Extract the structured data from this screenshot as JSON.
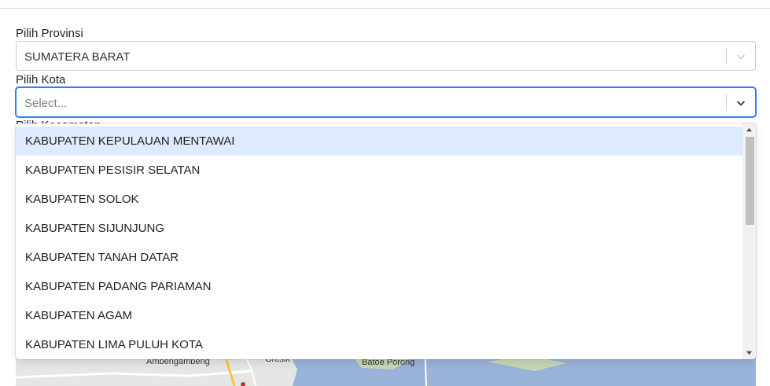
{
  "form": {
    "province_label": "Pilih Provinsi",
    "province_value": "SUMATERA BARAT",
    "city_label": "Pilih Kota",
    "city_placeholder": "Select...",
    "district_label": "Pilih Kecamatan"
  },
  "dropdown": {
    "options": [
      "KABUPATEN KEPULAUAN MENTAWAI",
      "KABUPATEN PESISIR SELATAN",
      "KABUPATEN SOLOK",
      "KABUPATEN SIJUNJUNG",
      "KABUPATEN TANAH DATAR",
      "KABUPATEN PADANG PARIAMAN",
      "KABUPATEN AGAM",
      "KABUPATEN LIMA PULUH KOTA"
    ],
    "highlighted_index": 0
  },
  "map": {
    "labels": [
      "Ambengambeng",
      "Gresik",
      "Batoe Porong"
    ]
  },
  "colors": {
    "focus_border": "#2684ff",
    "option_highlight": "#deebff",
    "map_water": "#9ab3d9",
    "map_land": "#e4e7e3"
  },
  "icons": {
    "dropdown_indicator": "chevron-down-icon",
    "scroll_up": "triangle-up-icon",
    "scroll_down": "triangle-down-icon"
  }
}
